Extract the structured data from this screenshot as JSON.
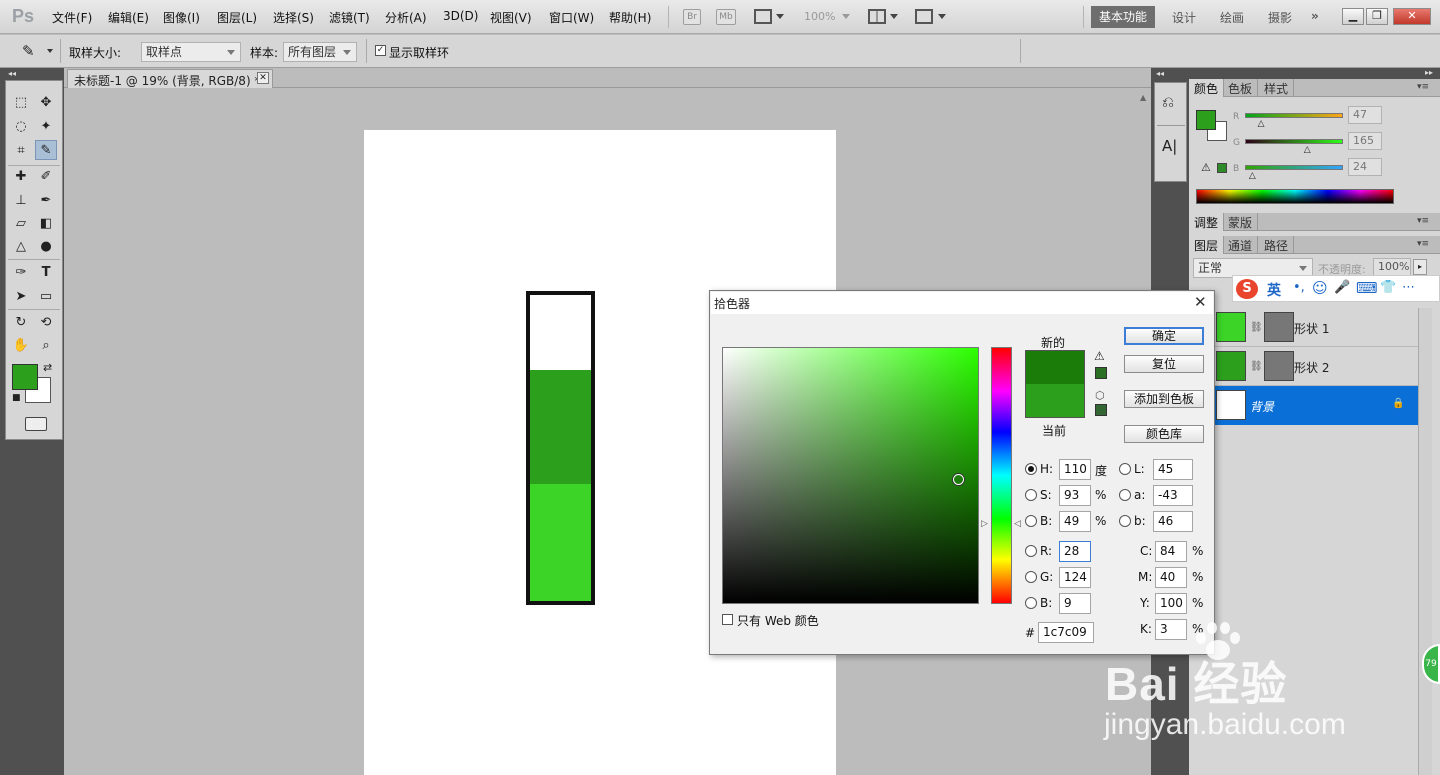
{
  "app": {
    "logo": "Ps"
  },
  "menu": [
    "文件(F)",
    "编辑(E)",
    "图像(I)",
    "图层(L)",
    "选择(S)",
    "滤镜(T)",
    "分析(A)",
    "3D(D)",
    "视图(V)",
    "窗口(W)",
    "帮助(H)"
  ],
  "menubar_right": {
    "br": "Br",
    "mb": "Mb",
    "zoom": "100%",
    "workspaces": [
      "基本功能",
      "设计",
      "绘画",
      "摄影"
    ],
    "more": "»"
  },
  "options_bar": {
    "sample_size_label": "取样大小:",
    "sample_size_value": "取样点",
    "sample_label": "样本:",
    "sample_value": "所有图层",
    "show_ring_label": "显示取样环",
    "show_ring_checked": true
  },
  "document": {
    "tab_title": "未标题-1 @ 19% (背景, RGB/8) *"
  },
  "colors": {
    "fg": "#2ca01c",
    "bg": "#ffffff",
    "shape_top": "#2ca01c",
    "shape_bottom": "#3bd427",
    "new_color": "#1c7c09",
    "current_color": "#2ca01c",
    "selected_layer": "#0a6fd6"
  },
  "color_panel": {
    "tabs": [
      "颜色",
      "色板",
      "样式"
    ],
    "r_label": "R",
    "r": "47",
    "g_label": "G",
    "g": "165",
    "b_label": "B",
    "b": "24",
    "r_frac": 0.18,
    "g_frac": 0.65,
    "b_frac": 0.09
  },
  "adjust_panel": {
    "tabs": [
      "调整",
      "蒙版"
    ]
  },
  "layers_panel": {
    "tabs": [
      "图层",
      "通道",
      "路径"
    ],
    "blend_mode": "正常",
    "opacity_label": "不透明度:",
    "opacity": "100%",
    "layers": [
      {
        "name": "形状 1"
      },
      {
        "name": "形状 2"
      },
      {
        "name": "背景"
      }
    ]
  },
  "ime": {
    "logo": "S",
    "mode": "英",
    "items": [
      "•,",
      "☺",
      "🎤",
      "⌨",
      "👕",
      "⋯"
    ]
  },
  "dialog": {
    "title": "拾色器",
    "new_label": "新的",
    "current_label": "当前",
    "buttons": {
      "ok": "确定",
      "reset": "复位",
      "add": "添加到色板",
      "library": "颜色库"
    },
    "web_only_label": "只有 Web 颜色",
    "fields": {
      "H": {
        "label": "H:",
        "value": "110",
        "unit": "度"
      },
      "S": {
        "label": "S:",
        "value": "93",
        "unit": "%"
      },
      "B": {
        "label": "B:",
        "value": "49",
        "unit": "%"
      },
      "R": {
        "label": "R:",
        "value": "28"
      },
      "G": {
        "label": "G:",
        "value": "124"
      },
      "Bb": {
        "label": "B:",
        "value": "9"
      },
      "L": {
        "label": "L:",
        "value": "45"
      },
      "a": {
        "label": "a:",
        "value": "-43"
      },
      "lab_b": {
        "label": "b:",
        "value": "46"
      },
      "C": {
        "label": "C:",
        "value": "84",
        "unit": "%"
      },
      "M": {
        "label": "M:",
        "value": "40",
        "unit": "%"
      },
      "Y": {
        "label": "Y:",
        "value": "100",
        "unit": "%"
      },
      "K": {
        "label": "K:",
        "value": "3",
        "unit": "%"
      },
      "hex_label": "#",
      "hex": "1c7c09"
    },
    "selected_mode": "H"
  },
  "watermark": {
    "logo": "Bai 经验",
    "url": "jingyan.baidu.com",
    "badge": "79"
  }
}
